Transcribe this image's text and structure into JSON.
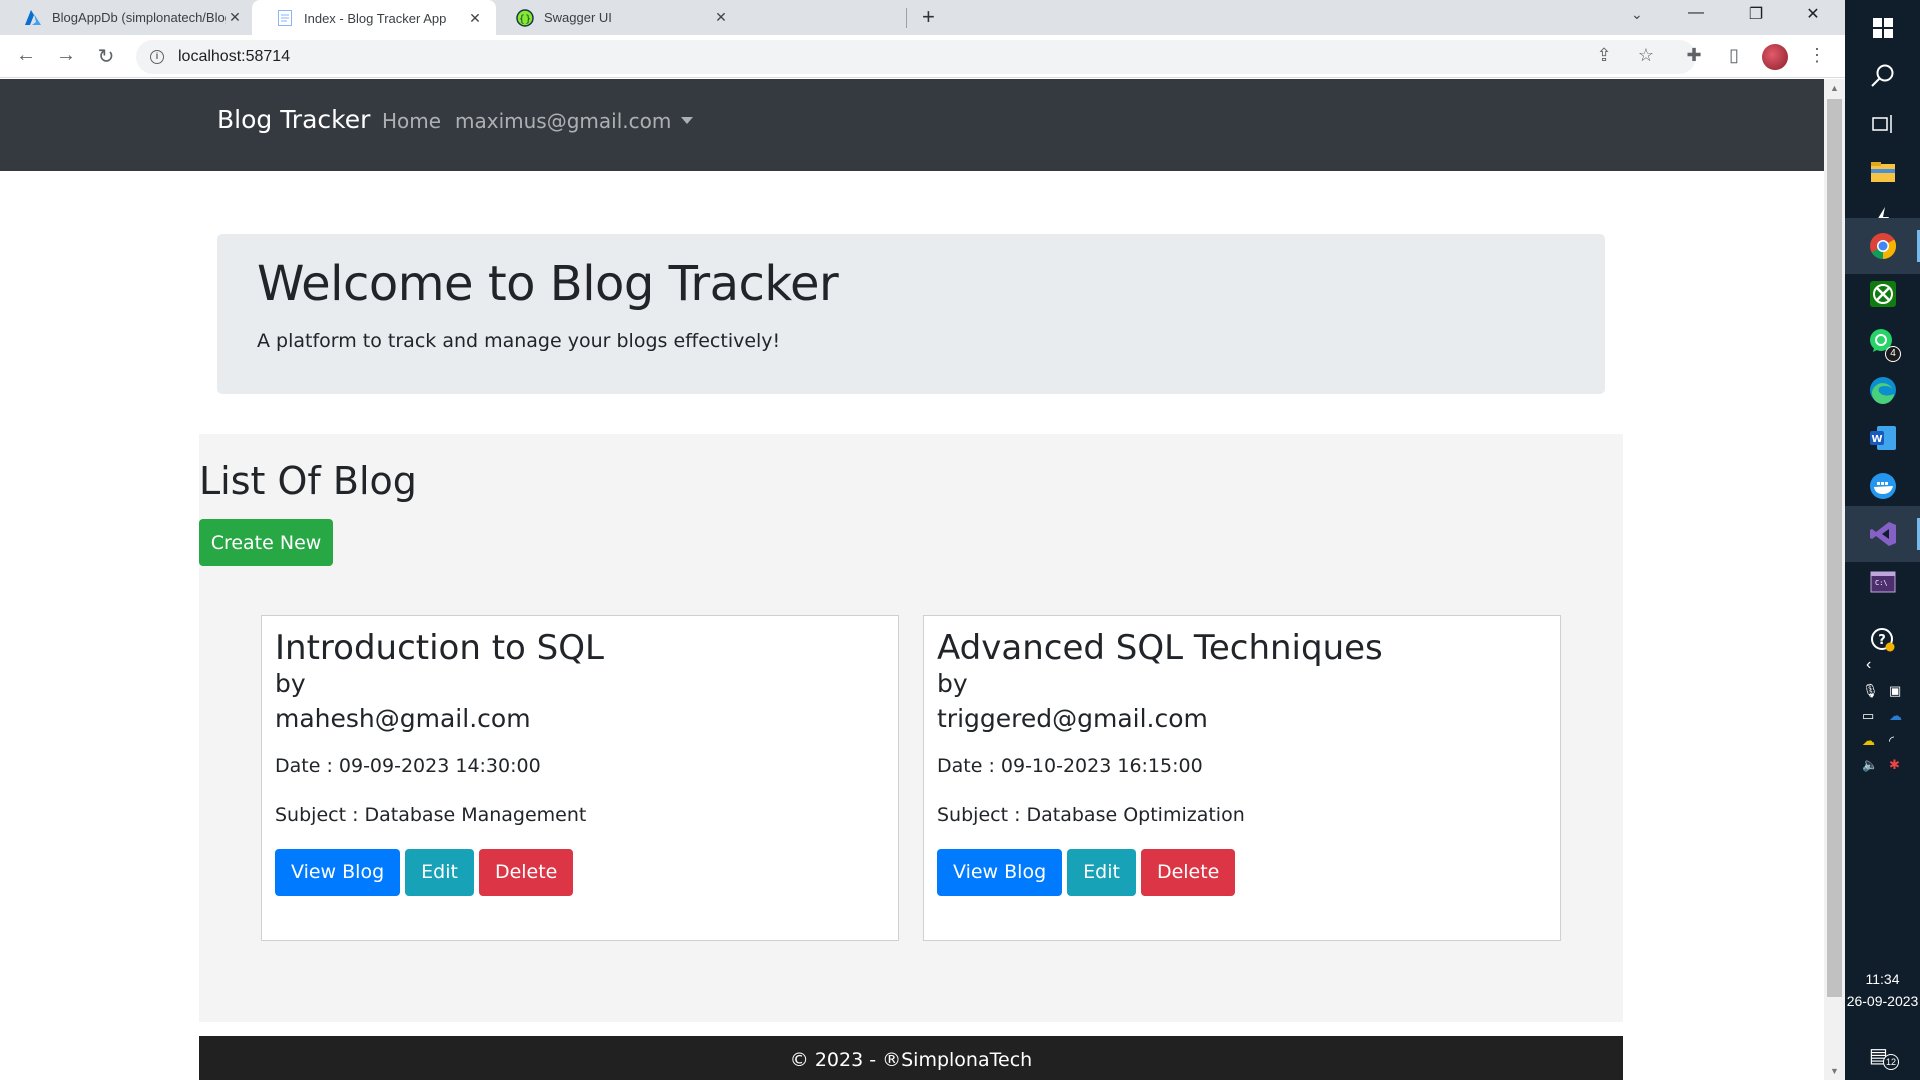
{
  "browser": {
    "tabs": [
      {
        "title": "BlogAppDb (simplonatech/Blog",
        "icon": "azure-icon",
        "active": false
      },
      {
        "title": "Index - Blog Tracker App",
        "icon": "page-icon",
        "active": true
      },
      {
        "title": "Swagger UI",
        "icon": "swagger-icon",
        "active": false
      }
    ],
    "url": "localhost:58714"
  },
  "app": {
    "brand": "Blog Tracker",
    "nav": {
      "home": "Home",
      "user": "maximus@gmail.com"
    },
    "jumbotron": {
      "title": "Welcome to Blog Tracker",
      "subtitle": "A platform to track and manage your blogs effectively!"
    },
    "list": {
      "title": "List Of Blog",
      "create_label": "Create New",
      "cards": [
        {
          "title": "Introduction to SQL",
          "by": "by",
          "author": "mahesh@gmail.com",
          "date": "Date : 09-09-2023 14:30:00",
          "subject": "Subject : Database Management",
          "view_label": "View Blog",
          "edit_label": "Edit",
          "delete_label": "Delete"
        },
        {
          "title": "Advanced SQL Techniques",
          "by": "by",
          "author": "triggered@gmail.com",
          "date": "Date : 09-10-2023 16:15:00",
          "subject": "Subject : Database Optimization",
          "view_label": "View Blog",
          "edit_label": "Edit",
          "delete_label": "Delete"
        }
      ]
    },
    "footer": "© 2023 - ®SimplonaTech"
  },
  "taskbar": {
    "whatsapp_badge": "4",
    "notifications_badge": "12",
    "time": "11:34",
    "date": "26-09-2023"
  },
  "colors": {
    "navbar": "#343a40",
    "jumbotron": "#e9ecef",
    "create_button": "#28a745",
    "view_button": "#007bff",
    "edit_button": "#17a2b8",
    "delete_button": "#dc3545",
    "footer": "#212121",
    "taskbar": "#101e2c"
  }
}
